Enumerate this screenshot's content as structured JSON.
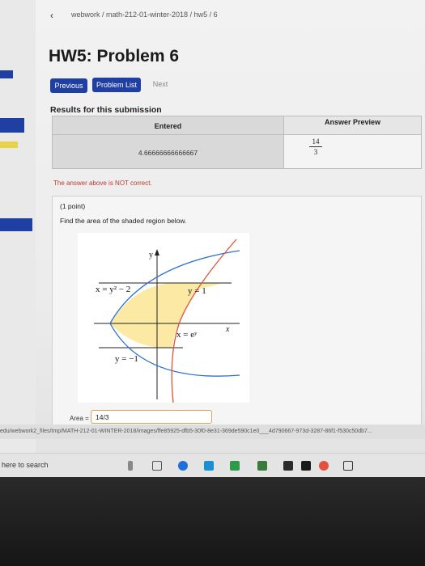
{
  "breadcrumb": "webwork / math-212-01-winter-2018 / hw5 / 6",
  "page_title": "HW5: Problem 6",
  "nav": {
    "previous": "Previous",
    "problem_list": "Problem List",
    "next": "Next"
  },
  "results": {
    "heading": "Results for this submission",
    "col_entered": "Entered",
    "col_preview": "Answer Preview",
    "entered_value": "4.66666666666667",
    "preview_numerator": "14",
    "preview_denominator": "3",
    "message": "The answer above is NOT correct."
  },
  "problem": {
    "points": "(1 point)",
    "text": "Find the area of the shaded region below.",
    "figure": {
      "y_axis": "y",
      "x_axis": "x",
      "curve1": "x = y² − 2",
      "line_top": "y = 1",
      "curve2": "x = eʸ",
      "line_bottom": "y = −1"
    },
    "area_label": "Area =",
    "area_value": "14/3"
  },
  "status_url": "edu/webwork2_files/tmp/MATH-212-01-WINTER-2018/images/ffe85925-dfb5-30f0-8e31-369de590c1e0___4d790667-973d-3287-86f1-f530c50db7...",
  "taskbar": {
    "search": "here to search"
  },
  "colors": {
    "button": "#1f3fa3",
    "error": "#c0392b",
    "shade": "#fbe9a4",
    "curve_blue": "#2a6fd6",
    "curve_red": "#e0533a"
  }
}
